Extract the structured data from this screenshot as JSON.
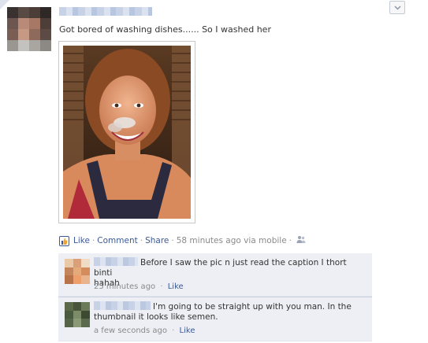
{
  "post": {
    "message": "Got bored of washing dishes...... So I washed her",
    "actions": {
      "like": "Like",
      "comment": "Comment",
      "share": "Share",
      "separator": "·",
      "timestamp": "58 minutes ago via mobile"
    }
  },
  "comments": [
    {
      "text_line1": "Before I saw the pic n just read the caption I thort binti",
      "text_line2": "hahah",
      "timestamp": "25 minutes ago",
      "like": "Like"
    },
    {
      "text_line1": "I'm going to be straight up with you man. In the",
      "text_line2": "thumbnail it looks like semen.",
      "timestamp": "a few seconds ago",
      "like": "Like"
    }
  ],
  "colors": {
    "link": "#3b5998",
    "meta": "#8a8a8a",
    "comment_bg": "#edeff4"
  },
  "icons": {
    "menu": "chevron-down-icon",
    "like": "like-thumb-icon",
    "audience": "people-icon"
  }
}
